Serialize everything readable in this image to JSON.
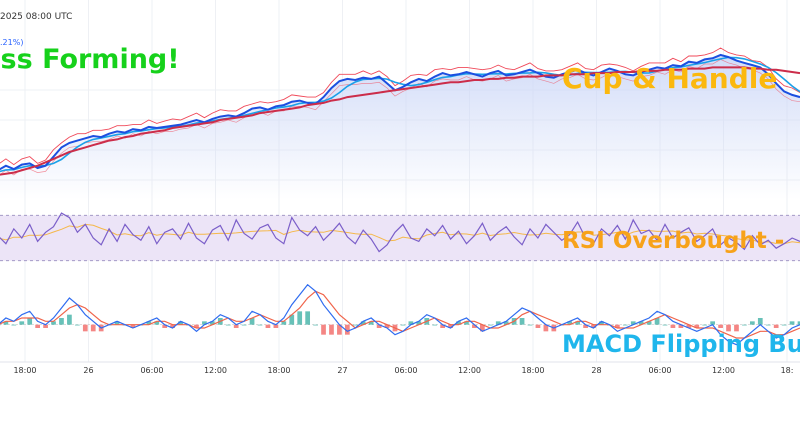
{
  "header": {
    "datetime": "2025 08:00 UTC",
    "change_pct": ".21%)"
  },
  "annotations": {
    "golden_cross": "oss Forming!",
    "cup_handle": "Cup & Handle",
    "rsi": "RSI Overbought -",
    "macd": "MACD Flipping Bu"
  },
  "colors": {
    "price_line": "#1c4fe0",
    "ema_fast": "#1aa0e8",
    "band_upper": "#f04a5a",
    "band_lower": "#f04a5a",
    "ma_long": "#cc2d4a",
    "area_fill": "#cdd8f7",
    "rsi_line": "#7b5fc9",
    "rsi_signal": "#f5b84a",
    "rsi_band": "#ece4f7",
    "macd_line": "#2f6cf0",
    "signal_line": "#f0644a",
    "hist_pos": "#26a69a",
    "hist_neg": "#ef5350",
    "golden": "#16d11b",
    "cup": "#fbb80e",
    "rsi_label": "#f7a21a",
    "macd_label": "#1fb6ec"
  },
  "chart_data": [
    {
      "type": "line",
      "title": "",
      "x_ticks": [
        "18:00",
        "26",
        "06:00",
        "12:00",
        "18:00",
        "27",
        "06:00",
        "12:00",
        "18:00",
        "28",
        "06:00",
        "12:00",
        "18:"
      ],
      "series": [
        {
          "role": "price",
          "values": [
            143,
            146,
            150,
            147,
            151,
            152,
            148,
            150,
            158,
            166,
            170,
            172,
            174,
            176,
            175,
            178,
            180,
            179,
            182,
            181,
            184,
            183,
            184,
            185,
            186,
            188,
            190,
            188,
            191,
            193,
            194,
            193,
            196,
            200,
            201,
            199,
            202,
            203,
            206,
            207,
            205,
            204,
            210,
            218,
            224,
            226,
            225,
            227,
            226,
            228,
            222,
            216,
            219,
            223,
            226,
            224,
            228,
            231,
            229,
            230,
            232,
            230,
            228,
            231,
            233,
            229,
            230,
            232,
            234,
            231,
            228,
            227,
            230,
            232,
            234,
            231,
            229,
            232,
            235,
            233,
            230,
            229,
            232,
            234,
            236,
            235,
            238,
            237,
            241,
            240,
            243,
            244,
            247,
            245,
            242,
            240,
            238,
            236,
            230,
            222,
            215,
            212,
            210
          ]
        },
        {
          "role": "ma_long",
          "values": [
            141,
            142,
            143,
            144,
            146,
            148,
            150,
            153,
            156,
            159,
            162,
            164,
            166,
            168,
            170,
            172,
            173,
            175,
            176,
            178,
            179,
            180,
            181,
            183,
            184,
            185,
            186,
            187,
            188,
            190,
            191,
            192,
            193,
            194,
            196,
            197,
            198,
            199,
            200,
            201,
            203,
            204,
            205,
            207,
            208,
            210,
            211,
            212,
            213,
            214,
            215,
            216,
            217,
            218,
            219,
            220,
            221,
            222,
            223,
            223,
            224,
            225,
            225,
            226,
            226,
            227,
            227,
            228,
            228,
            228,
            229,
            229,
            229,
            230,
            230,
            230,
            231,
            231,
            231,
            232,
            232,
            232,
            233,
            233,
            233,
            234,
            234,
            234,
            235,
            235,
            235,
            236,
            236,
            236,
            236,
            236,
            235,
            235,
            234,
            234,
            233,
            232,
            231
          ]
        }
      ],
      "ylim": [
        120,
        260
      ]
    },
    {
      "type": "line",
      "title": "",
      "series": [
        {
          "role": "rsi",
          "values": [
            48,
            52,
            45,
            58,
            50,
            62,
            47,
            55,
            60,
            72,
            68,
            55,
            62,
            50,
            44,
            58,
            47,
            62,
            53,
            48,
            60,
            45,
            55,
            58,
            49,
            63,
            50,
            45,
            57,
            61,
            48,
            66,
            54,
            49,
            59,
            62,
            50,
            45,
            68,
            57,
            52,
            60,
            48,
            55,
            63,
            51,
            45,
            57,
            49,
            38,
            44,
            55,
            62,
            50,
            47,
            58,
            52,
            61,
            49,
            56,
            45,
            52,
            63,
            48,
            55,
            60,
            51,
            44,
            58,
            50,
            62,
            55,
            48,
            53,
            64,
            50,
            45,
            58,
            52,
            61,
            49,
            66,
            54,
            57,
            48,
            62,
            50,
            55,
            59,
            47,
            52,
            58,
            44,
            50,
            46,
            40,
            52,
            44,
            48,
            41,
            45,
            50,
            47
          ]
        }
      ],
      "ylim": [
        20,
        80
      ],
      "bands": [
        30,
        70
      ]
    },
    {
      "type": "line",
      "title": "",
      "series": [
        {
          "role": "macd",
          "values": [
            -1,
            0,
            2,
            1,
            3,
            4,
            1,
            0,
            2,
            5,
            8,
            6,
            3,
            1,
            -1,
            0,
            1,
            0,
            -1,
            0,
            1,
            2,
            0,
            -1,
            1,
            0,
            -2,
            0,
            1,
            3,
            2,
            0,
            1,
            4,
            3,
            1,
            0,
            2,
            6,
            9,
            12,
            10,
            6,
            3,
            0,
            -2,
            -1,
            1,
            2,
            0,
            -1,
            -3,
            -2,
            0,
            1,
            3,
            2,
            0,
            -1,
            1,
            2,
            0,
            -2,
            -1,
            0,
            1,
            3,
            5,
            4,
            2,
            0,
            -1,
            0,
            1,
            2,
            0,
            -1,
            1,
            0,
            -2,
            -1,
            0,
            1,
            2,
            4,
            3,
            1,
            0,
            -1,
            -2,
            -1,
            0,
            -3,
            -5,
            -6,
            -4,
            -2,
            0,
            -2,
            -4,
            -3,
            -1,
            0
          ]
        },
        {
          "role": "signal",
          "values": [
            0,
            0,
            1,
            1,
            2,
            2,
            2,
            1,
            1,
            3,
            5,
            6,
            5,
            3,
            1,
            0,
            0,
            0,
            0,
            0,
            0,
            1,
            1,
            0,
            0,
            0,
            -1,
            -1,
            0,
            1,
            2,
            1,
            1,
            2,
            3,
            2,
            1,
            1,
            3,
            5,
            8,
            10,
            9,
            6,
            3,
            1,
            -1,
            0,
            1,
            1,
            0,
            -1,
            -2,
            -1,
            0,
            1,
            2,
            1,
            0,
            0,
            1,
            1,
            0,
            -1,
            -1,
            0,
            1,
            3,
            4,
            3,
            2,
            1,
            0,
            0,
            1,
            1,
            0,
            0,
            0,
            -1,
            -1,
            -1,
            0,
            1,
            2,
            3,
            2,
            1,
            0,
            -1,
            -1,
            -1,
            -2,
            -3,
            -4,
            -4,
            -3,
            -2,
            -2,
            -3,
            -3,
            -2,
            -1
          ]
        }
      ],
      "ylim": [
        -10,
        14
      ]
    }
  ]
}
